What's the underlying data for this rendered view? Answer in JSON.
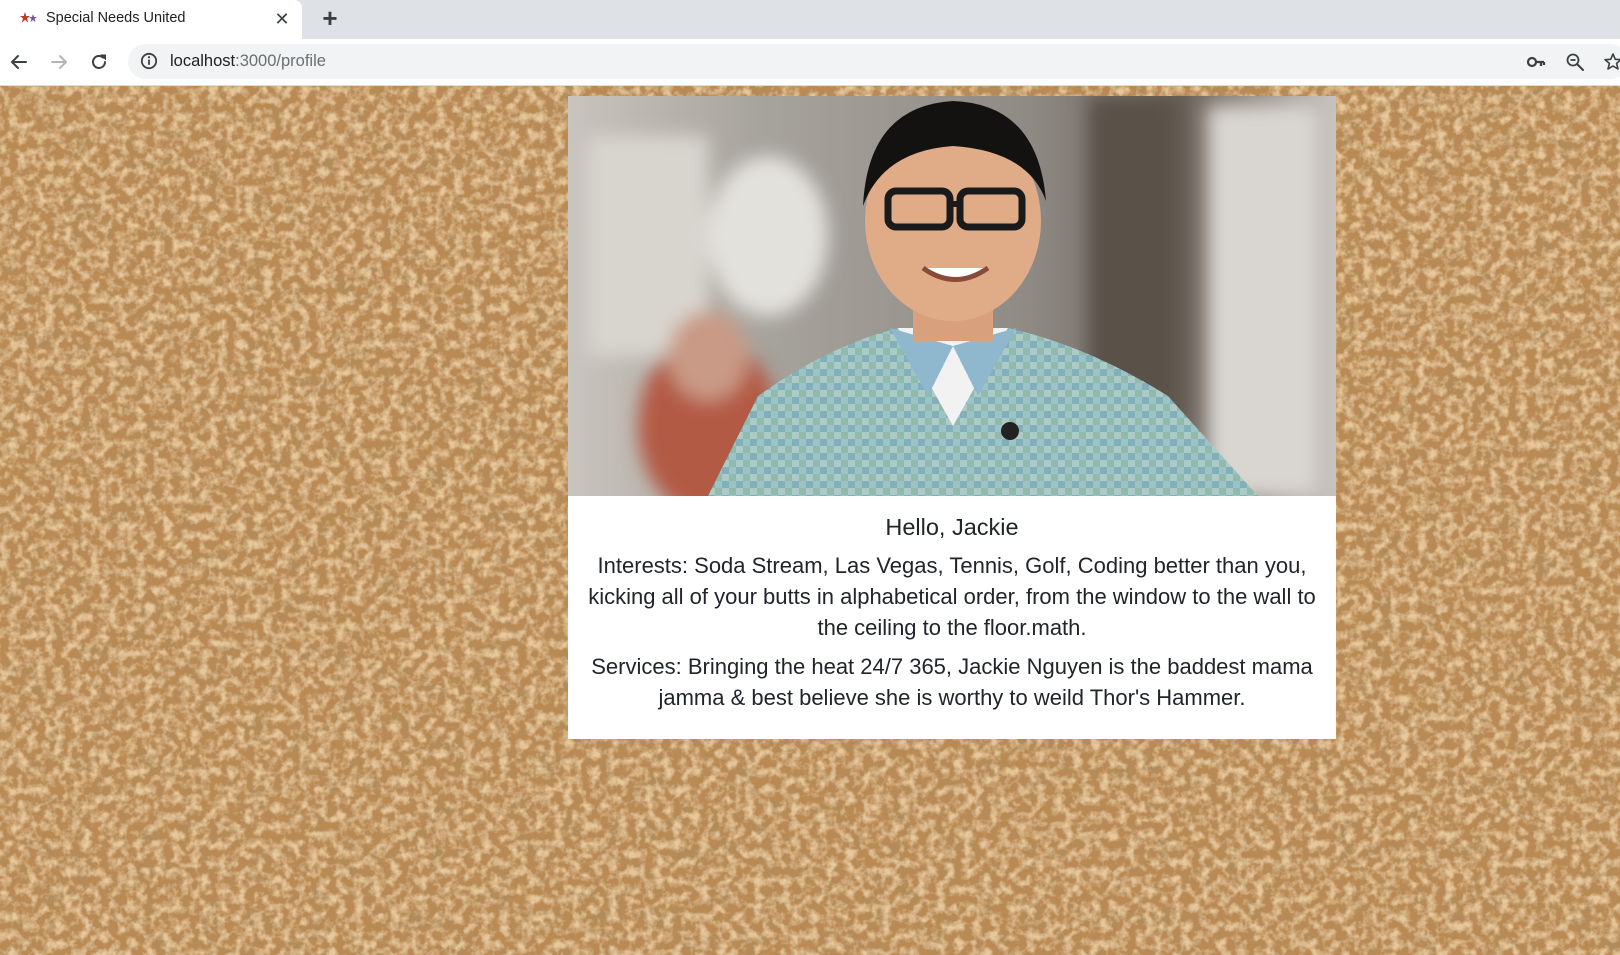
{
  "browser": {
    "tab": {
      "title": "Special Needs United",
      "favicon": "star-figures-icon"
    },
    "address_bar": {
      "host": "localhost",
      "path": ":3000/profile"
    },
    "icons": {
      "back": "back-arrow-icon",
      "forward": "forward-arrow-icon",
      "reload": "reload-icon",
      "site_info": "info-icon",
      "passwords": "key-icon",
      "zoom": "zoom-out-icon",
      "bookmark": "star-icon"
    }
  },
  "profile": {
    "photo_alt": "photo",
    "greeting": "Hello, Jackie",
    "interests": "Interests: Soda Stream, Las Vegas, Tennis, Golf, Coding better than you, kicking all of your butts in alphabetical order, from the window to the wall to the ceiling to the floor.math.",
    "services": "Services: Bringing the heat 24/7 365, Jackie Nguyen is the baddest mama jamma & best believe she is worthy to weild Thor's Hammer."
  },
  "colors": {
    "tabstrip": "#dee1e6",
    "omnibox": "#f1f3f4",
    "cork_base": "#b98a52",
    "card_bg": "#ffffff",
    "text": "#212529"
  }
}
